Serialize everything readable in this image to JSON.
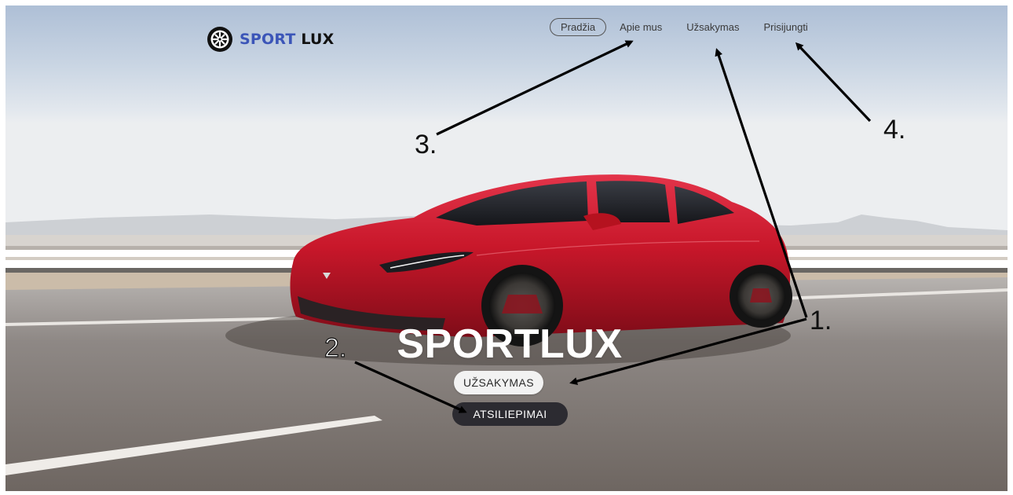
{
  "logo": {
    "brand_first": "SPORT",
    "brand_second": "LUX",
    "icon": "wheel-icon",
    "accent_color": "#3b55b8"
  },
  "nav": {
    "items": [
      {
        "label": "Pradžia",
        "active": true
      },
      {
        "label": "Apie mus",
        "active": false
      },
      {
        "label": "Užsakymas",
        "active": false
      },
      {
        "label": "Prisijungti",
        "active": false
      }
    ]
  },
  "hero": {
    "title": "SPORTLUX",
    "primary_button": "UŽSAKYMAS",
    "secondary_button": "ATSILIEPIMAI",
    "car_color": "#c8172a"
  },
  "annotations": {
    "labels": [
      "1.",
      "2.",
      "3.",
      "4."
    ]
  }
}
